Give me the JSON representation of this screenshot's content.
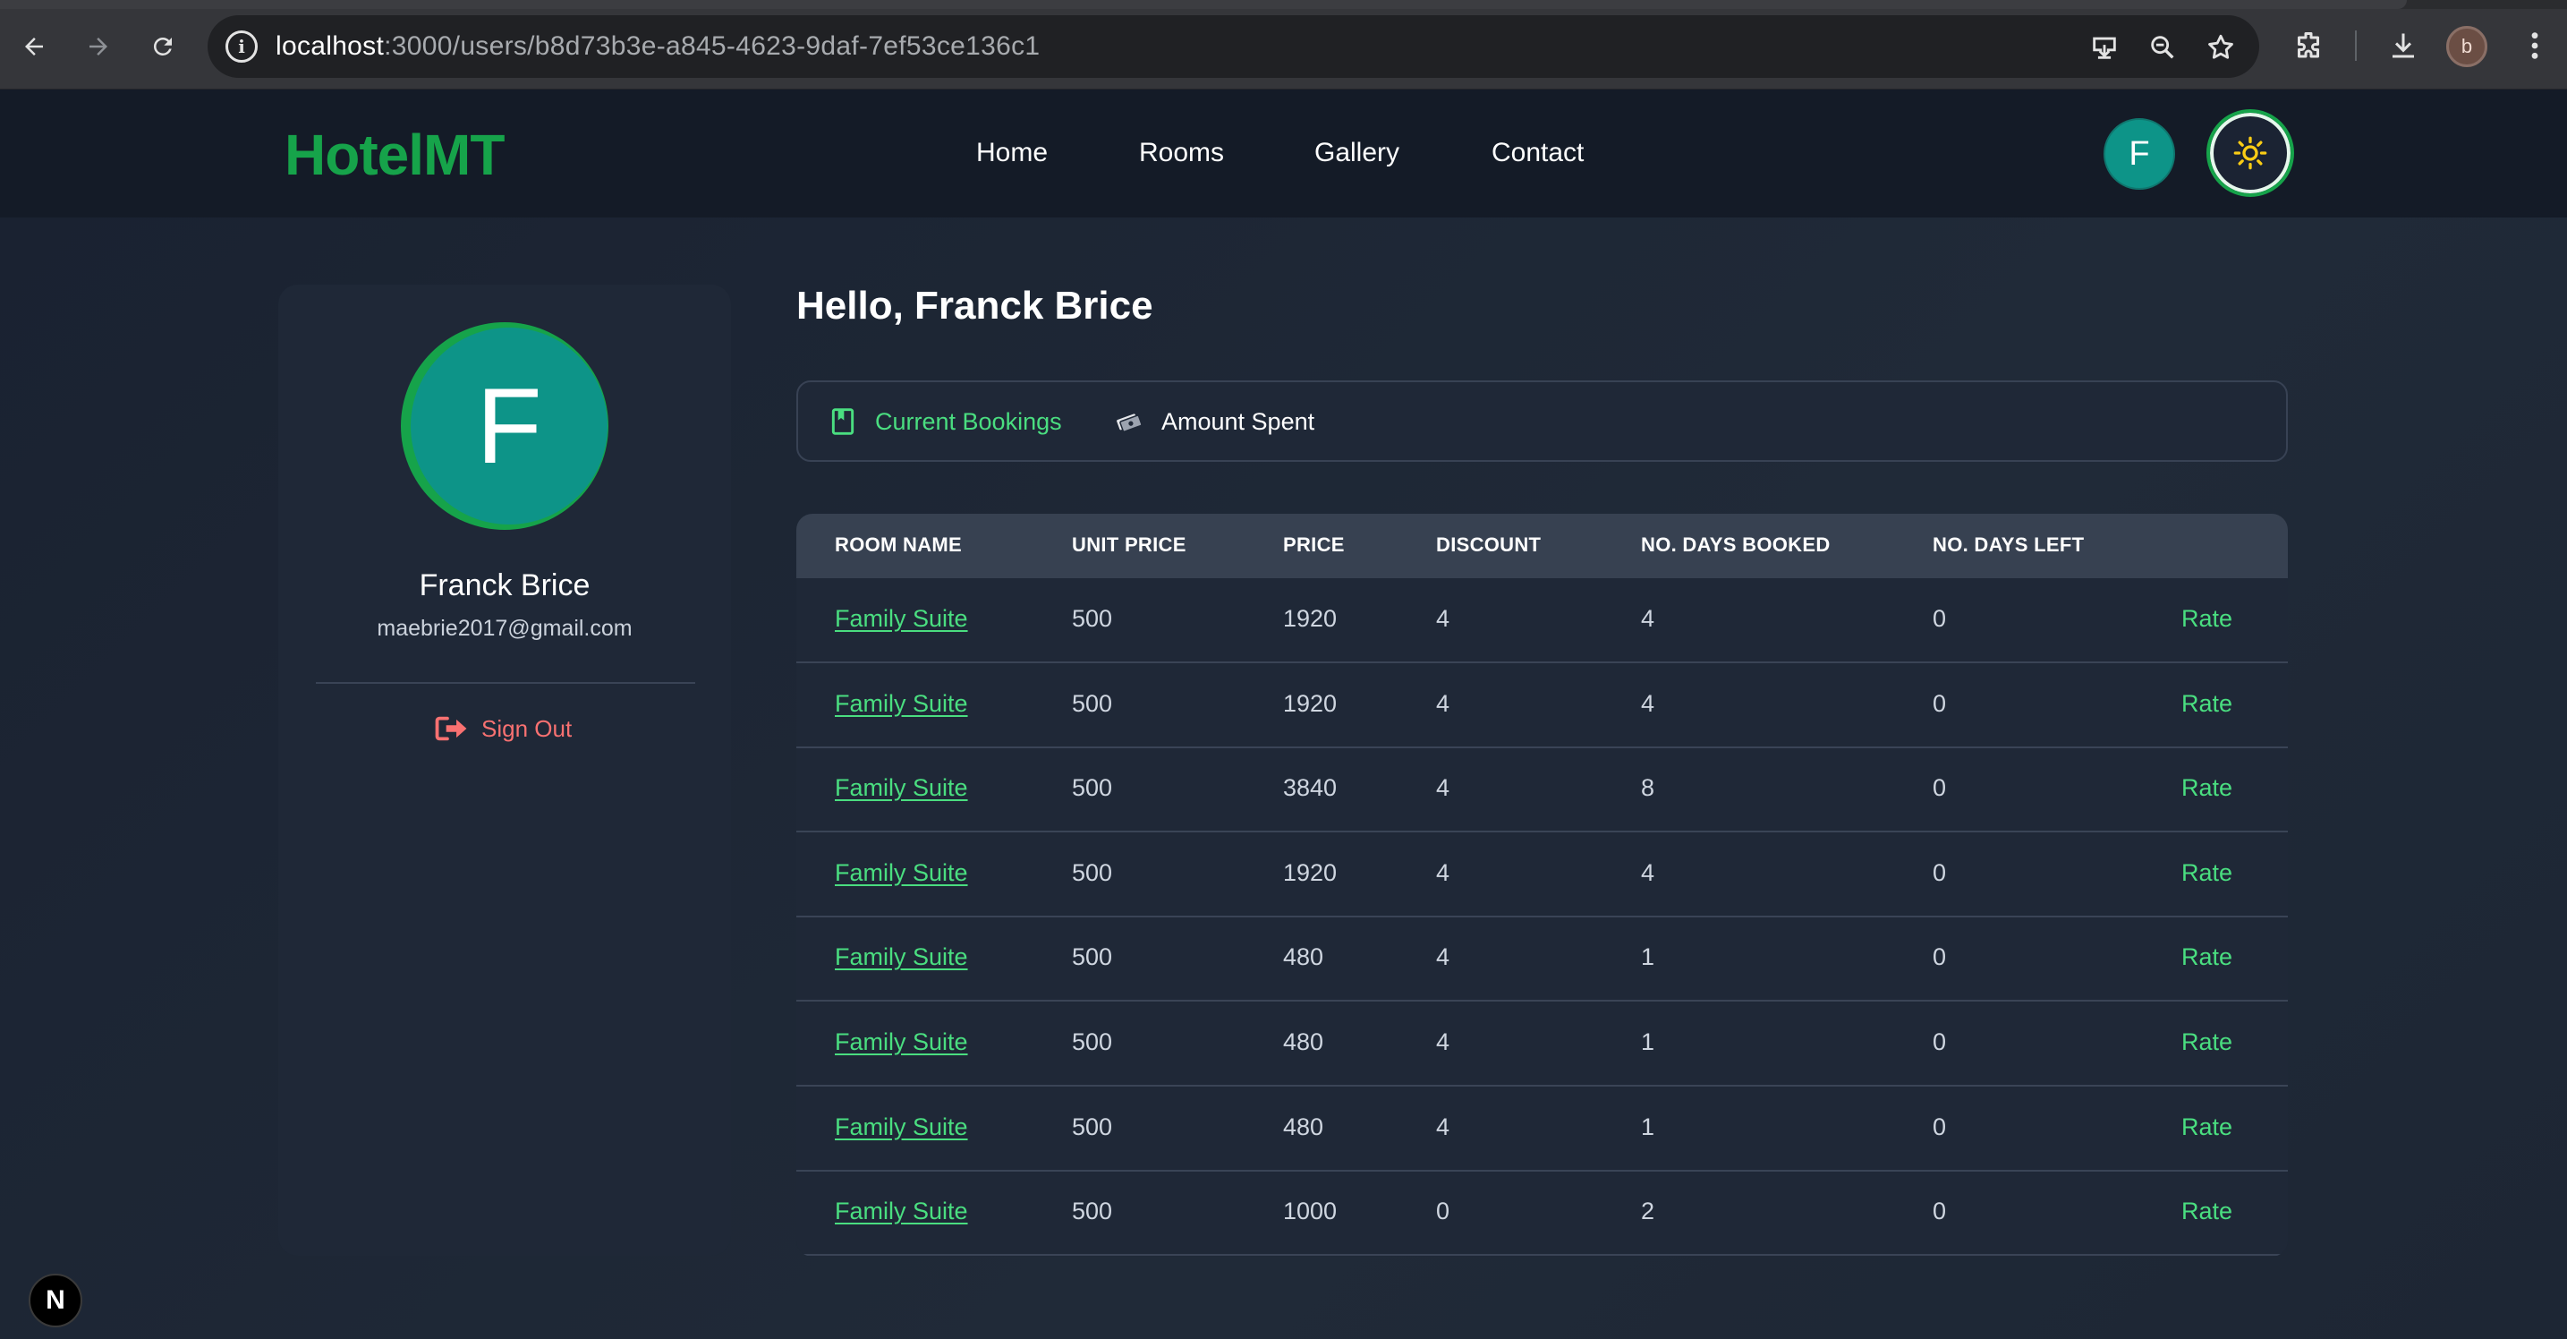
{
  "browser": {
    "url_host": "localhost",
    "url_path": ":3000/users/b8d73b3e-a845-4623-9daf-7ef53ce136c1",
    "profile_initial": "b"
  },
  "header": {
    "logo": "HotelMT",
    "nav": [
      "Home",
      "Rooms",
      "Gallery",
      "Contact"
    ],
    "avatar_initial": "F"
  },
  "profile": {
    "initial": "F",
    "name": "Franck Brice",
    "email": "maebrie2017@gmail.com",
    "sign_out": "Sign Out"
  },
  "main": {
    "greeting": "Hello, Franck Brice",
    "tabs": [
      {
        "label": "Current Bookings",
        "active": true
      },
      {
        "label": "Amount Spent",
        "active": false
      }
    ]
  },
  "table": {
    "headers": [
      "ROOM NAME",
      "UNIT PRICE",
      "PRICE",
      "DISCOUNT",
      "NO. DAYS BOOKED",
      "NO. DAYS LEFT"
    ],
    "rows": [
      {
        "room": "Family Suite",
        "unit_price": "500",
        "price": "1920",
        "discount": "4",
        "days_booked": "4",
        "days_left": "0",
        "action": "Rate"
      },
      {
        "room": "Family Suite",
        "unit_price": "500",
        "price": "1920",
        "discount": "4",
        "days_booked": "4",
        "days_left": "0",
        "action": "Rate"
      },
      {
        "room": "Family Suite",
        "unit_price": "500",
        "price": "3840",
        "discount": "4",
        "days_booked": "8",
        "days_left": "0",
        "action": "Rate"
      },
      {
        "room": "Family Suite",
        "unit_price": "500",
        "price": "1920",
        "discount": "4",
        "days_booked": "4",
        "days_left": "0",
        "action": "Rate"
      },
      {
        "room": "Family Suite",
        "unit_price": "500",
        "price": "480",
        "discount": "4",
        "days_booked": "1",
        "days_left": "0",
        "action": "Rate"
      },
      {
        "room": "Family Suite",
        "unit_price": "500",
        "price": "480",
        "discount": "4",
        "days_booked": "1",
        "days_left": "0",
        "action": "Rate"
      },
      {
        "room": "Family Suite",
        "unit_price": "500",
        "price": "480",
        "discount": "4",
        "days_booked": "1",
        "days_left": "0",
        "action": "Rate"
      },
      {
        "room": "Family Suite",
        "unit_price": "500",
        "price": "1000",
        "discount": "0",
        "days_booked": "2",
        "days_left": "0",
        "action": "Rate"
      }
    ]
  },
  "dev_badge": "N",
  "colors": {
    "accent_green": "#16a34a",
    "link_green": "#4ade80",
    "avatar_teal": "#0d9488",
    "signout_red": "#f87171"
  },
  "icons": {
    "back": "arrow-left-icon",
    "forward": "arrow-right-icon",
    "reload": "reload-icon",
    "site_info": "info-icon",
    "install": "install-app-icon",
    "zoom": "zoom-icon",
    "bookmark": "star-icon",
    "extensions": "puzzle-icon",
    "downloads": "download-icon",
    "menu": "kebab-menu-icon",
    "theme": "sun-icon",
    "sign_out": "sign-out-icon",
    "bookings": "book-icon",
    "amount": "money-icon"
  }
}
